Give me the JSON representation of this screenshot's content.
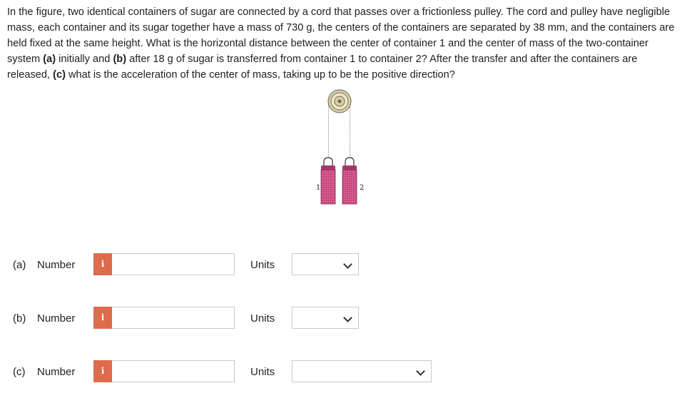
{
  "question": {
    "segments": [
      {
        "text": "In the figure, two identical containers of sugar are connected by a cord that passes over a frictionless pulley. The cord and pulley have negligible mass, each container and its sugar together have a mass of 730 g, the centers of the containers are separated by 38 mm, and the containers are held fixed at the same height. What is the horizontal distance between the center of container 1 and the center of mass of the two-container system ",
        "bold": false
      },
      {
        "text": "(a)",
        "bold": true
      },
      {
        "text": " initially and ",
        "bold": false
      },
      {
        "text": "(b)",
        "bold": true
      },
      {
        "text": " after 18 g of sugar is transferred from container 1 to container 2? After the transfer and after the containers are released, ",
        "bold": false
      },
      {
        "text": "(c)",
        "bold": true
      },
      {
        "text": " what is the acceleration of the center of mass, taking up to be the positive direction?",
        "bold": false
      }
    ]
  },
  "figure": {
    "label_1": "1",
    "label_2": "2",
    "container_color": "#c8487d",
    "pulley_color": "#d9cf9f"
  },
  "parts": [
    {
      "part_label": "(a)",
      "number_label": "Number",
      "info_icon": "i",
      "value": "",
      "units_label": "Units",
      "units_value": ""
    },
    {
      "part_label": "(b)",
      "number_label": "Number",
      "info_icon": "i",
      "value": "",
      "units_label": "Units",
      "units_value": ""
    },
    {
      "part_label": "(c)",
      "number_label": "Number",
      "info_icon": "i",
      "value": "",
      "units_label": "Units",
      "units_value": ""
    }
  ],
  "colors": {
    "info_button": "#de6b4c",
    "input_border": "#c9c9c9"
  }
}
